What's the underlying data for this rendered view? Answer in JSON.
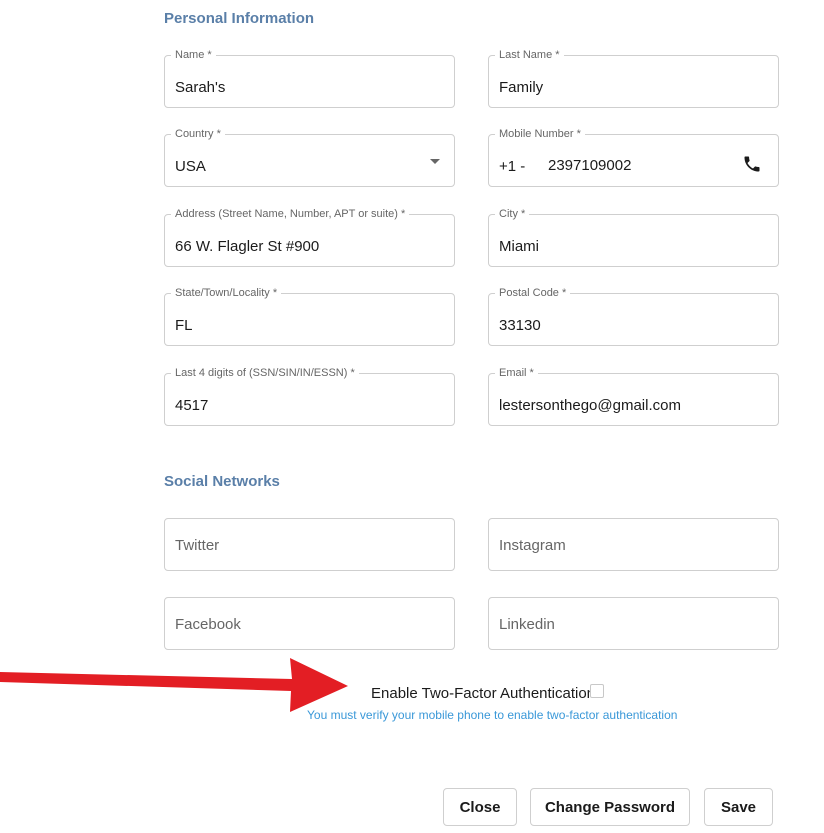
{
  "personal": {
    "title": "Personal Information",
    "fields": {
      "name": {
        "label": "Name *",
        "value": "Sarah's"
      },
      "last_name": {
        "label": "Last Name *",
        "value": "Family"
      },
      "country": {
        "label": "Country *",
        "value": "USA"
      },
      "mobile": {
        "label": "Mobile Number *",
        "prefix": "+1 -",
        "value": "2397109002"
      },
      "address": {
        "label": "Address (Street Name, Number, APT or suite) *",
        "value": "66 W. Flagler St #900"
      },
      "city": {
        "label": "City *",
        "value": "Miami"
      },
      "state": {
        "label": "State/Town/Locality *",
        "value": "FL"
      },
      "postal": {
        "label": "Postal Code *",
        "value": "33130"
      },
      "ssn": {
        "label": "Last 4 digits of (SSN/SIN/IN/ESSN) *",
        "value": "4517"
      },
      "email": {
        "label": "Email *",
        "value": "lestersonthego@gmail.com"
      }
    }
  },
  "social": {
    "title": "Social Networks",
    "twitter_placeholder": "Twitter",
    "instagram_placeholder": "Instagram",
    "facebook_placeholder": "Facebook",
    "linkedin_placeholder": "Linkedin"
  },
  "two_factor": {
    "label": "Enable Two-Factor Authentication",
    "checked": false,
    "note": "You must verify your mobile phone to enable two-factor authentication"
  },
  "buttons": {
    "close": "Close",
    "change_password": "Change Password",
    "save": "Save"
  },
  "colors": {
    "section_title": "#5a7fa8",
    "note_link": "#3a98d8",
    "arrow": "#e31e24"
  },
  "icons": {
    "phone": "phone-icon",
    "country_dropdown": "chevron-down-icon",
    "annotation": "arrow-icon"
  }
}
